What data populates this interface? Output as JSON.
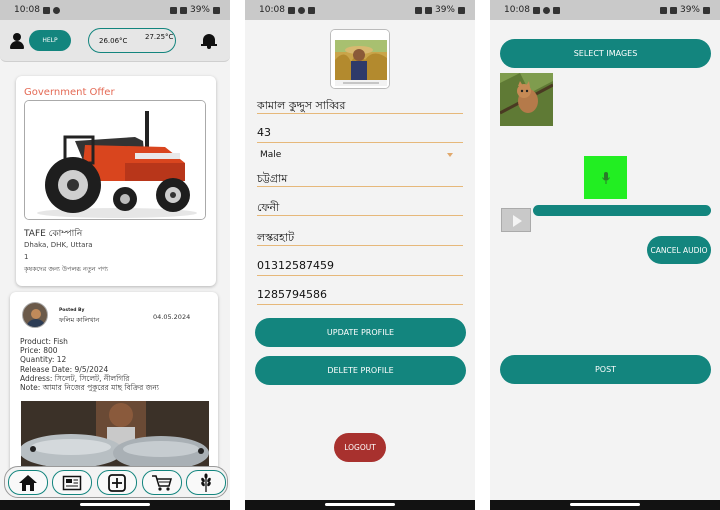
{
  "status_bar": {
    "time": "10:08",
    "battery": "39%"
  },
  "home": {
    "help_label": "HELP",
    "temp_current": "26.06°C",
    "temp_forecast": "27.25°C",
    "temp_forecast_sub": "",
    "offer_card": {
      "heading": "Government Offer",
      "brand": "TAFE কোম্পানি",
      "location": "Dhaka, DHK, Uttara",
      "quantity": "1",
      "description": "কৃষকদের জন্য উপলব্ধ নতুন পণ্য"
    },
    "post_card": {
      "posted_by_label": "Posted By",
      "poster_name": "ফলিম কালিখান",
      "date": "04.05.2024",
      "product": "Product: Fish",
      "price": "Price: 800",
      "quantity": "Quantity: 12",
      "release_date": "Release Date: 9/5/2024",
      "address": "Address: সিলেট, সিলেট, নীলগিরি",
      "note": "Note: আমার নিজের পুকুরের মাছ বিক্রির জন্য"
    },
    "nav": [
      "home-icon",
      "newspaper-icon",
      "add-icon",
      "cart-icon",
      "wheat-icon"
    ]
  },
  "profile": {
    "name": "কামাল কুদ্দুস সাব্বির",
    "age": "43",
    "gender": "Male",
    "division": "চট্টগ্রাম",
    "district": "ফেনী",
    "upazila": "লস্করহাট",
    "phone": "01312587459",
    "nid": "1285794586",
    "update_label": "UPDATE PROFILE",
    "delete_label": "DELETE PROFILE",
    "logout_label": "LOGOUT"
  },
  "post_form": {
    "select_images_label": "SELECT IMAGES",
    "cancel_audio_label": "CANCEL AUDIO",
    "post_label": "POST",
    "audio_progress": 1.0
  },
  "colors": {
    "teal": "#13857e",
    "logout_red": "#a8312e",
    "mic_green": "#22ee22",
    "offer_orange": "#e46a55"
  }
}
